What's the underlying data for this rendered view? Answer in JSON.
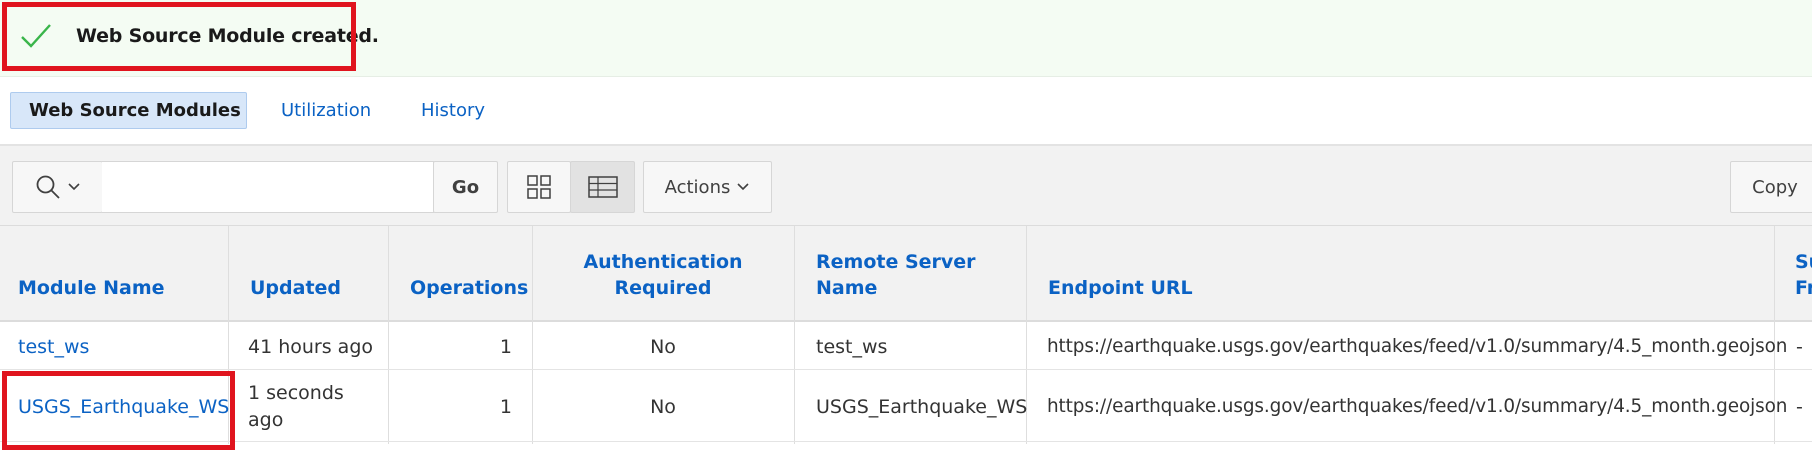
{
  "banner": {
    "message": "Web Source Module created.",
    "icon": "check-icon",
    "color": "#39b54a"
  },
  "tabs": [
    {
      "label": "Web Source Modules",
      "active": true
    },
    {
      "label": "Utilization",
      "active": false
    },
    {
      "label": "History",
      "active": false
    }
  ],
  "toolbar": {
    "search_value": "",
    "go_label": "Go",
    "actions_label": "Actions",
    "copy_label": "Copy",
    "view_modes": [
      "grid-view-icon",
      "list-view-icon"
    ],
    "selected_view": "list-view-icon"
  },
  "table": {
    "headers": {
      "module_name": "Module Name",
      "updated": "Updated",
      "operations": "Operations",
      "auth_line1": "Authentication",
      "auth_line2": "Required",
      "remote_line1": "Remote Server",
      "remote_line2": "Name",
      "endpoint": "Endpoint URL",
      "next_line1": "Su",
      "next_line2": "Fr"
    },
    "rows": [
      {
        "module_name": "test_ws",
        "updated_line1": "41 hours ago",
        "updated_line2": "",
        "operations": "1",
        "auth_required": "No",
        "remote_server": "test_ws",
        "endpoint": "https://earthquake.usgs.gov/earthquakes/feed/v1.0/summary/4.5_month.geojson",
        "next_col": "-"
      },
      {
        "module_name": "USGS_Earthquake_WS",
        "updated_line1": "1 seconds",
        "updated_line2": "ago",
        "operations": "1",
        "auth_required": "No",
        "remote_server": "USGS_Earthquake_WS",
        "endpoint": "https://earthquake.usgs.gov/earthquakes/feed/v1.0/summary/4.5_month.geojson",
        "next_col": "-"
      }
    ]
  },
  "colors": {
    "accent": "#0b62c4",
    "highlight": "#e0141e",
    "active_tab": "#d8e7f9"
  }
}
